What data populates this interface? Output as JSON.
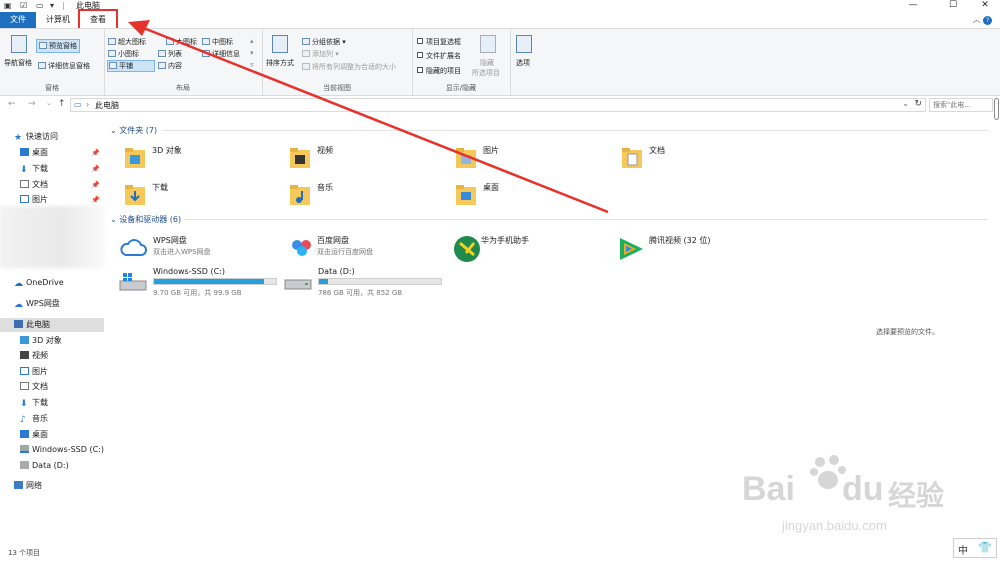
{
  "window": {
    "title": "此电脑",
    "controls": [
      "—",
      "☐",
      "✕"
    ]
  },
  "tabs": {
    "file": "文件",
    "computer": "计算机",
    "view": "查看"
  },
  "ribbon": {
    "panes": {
      "nav_pane": "导航窗格",
      "preview_pane": "预览窗格",
      "details_pane": "详细信息窗格",
      "group_label": "窗格"
    },
    "layout": {
      "extra_large": "超大图标",
      "large": "大图标",
      "medium": "中图标",
      "small": "小图标",
      "list": "列表",
      "details": "详细信息",
      "tiles": "平铺",
      "content": "内容",
      "group_label": "布局"
    },
    "current_view": {
      "sort_by": "排序方式",
      "group_by": "分组依据",
      "add_columns": "添加列",
      "size_all_columns": "将所有列调整为合适的大小",
      "group_label": "当前视图"
    },
    "show_hide": {
      "item_checkboxes": "项目复选框",
      "file_extensions": "文件扩展名",
      "hidden_items": "隐藏的项目",
      "hide_selected": "隐藏",
      "hide_selected_2": "所选项目",
      "group_label": "显示/隐藏"
    },
    "options": "选项"
  },
  "address": {
    "path": "此电脑",
    "search_placeholder": "搜索\"此电..."
  },
  "navpane": {
    "quick_access": "快速访问",
    "qa_items": [
      "桌面",
      "下载",
      "文档",
      "图片"
    ],
    "onedrive": "OneDrive",
    "wps": "WPS网盘",
    "this_pc": "此电脑",
    "pc_items": [
      "3D 对象",
      "视频",
      "图片",
      "文档",
      "下载",
      "音乐",
      "桌面",
      "Windows-SSD (C:)",
      "Data (D:)"
    ],
    "network": "网络"
  },
  "content": {
    "folders_header": "文件夹 (7)",
    "folders": [
      "3D 对象",
      "视频",
      "图片",
      "文档",
      "下载",
      "音乐",
      "桌面"
    ],
    "devices_header": "设备和驱动器 (6)",
    "devices": [
      {
        "name": "WPS网盘",
        "sub": "双击进入WPS网盘"
      },
      {
        "name": "百度网盘",
        "sub": "双击运行百度网盘"
      },
      {
        "name": "华为手机助手",
        "sub": ""
      },
      {
        "name": "腾讯视频 (32 位)",
        "sub": ""
      }
    ],
    "drives": [
      {
        "name": "Windows-SSD (C:)",
        "sub": "9.70 GB 可用，共 99.9 GB",
        "used_fraction": 0.903
      },
      {
        "name": "Data (D:)",
        "sub": "786 GB 可用，共 852 GB",
        "used_fraction": 0.077
      }
    ],
    "preview_hint": "选择要预览的文件。"
  },
  "status": {
    "count": "13 个项目"
  },
  "ime": {
    "label": "中"
  },
  "watermark": {
    "brand": "Bai",
    "brand2": "du",
    "cn": "经验",
    "url": "jingyan.baidu.com"
  },
  "colors": {
    "accent": "#1e6fc0",
    "highlight_red": "#e8302c",
    "drive_fill": "#26a0da"
  }
}
